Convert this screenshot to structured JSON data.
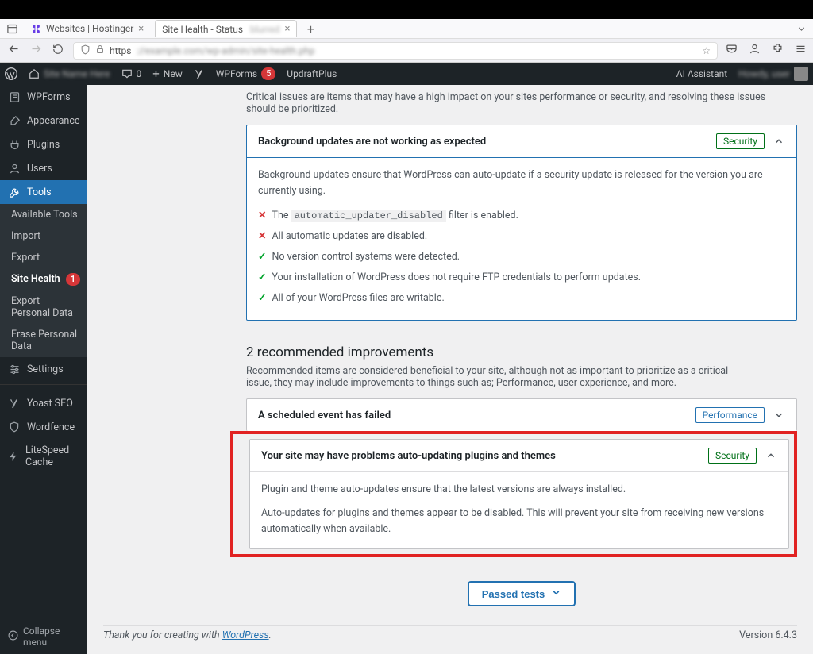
{
  "browser": {
    "tab1": "Websites | Hostinger",
    "tab2": "Site Health - Status",
    "url_prefix": "https",
    "url_rest": "://example.com/wp-admin/site-health.php",
    "add_tab": "+"
  },
  "adminbar": {
    "comments": "0",
    "new": "New",
    "wpforms": "WPForms",
    "wpforms_count": "5",
    "updraft": "UpdraftPlus",
    "aiassist": "AI Assistant",
    "howdy": "Howdy, user"
  },
  "sidebar": {
    "wpforms": "WPForms",
    "appearance": "Appearance",
    "plugins": "Plugins",
    "users": "Users",
    "tools": "Tools",
    "sub_available": "Available Tools",
    "sub_import": "Import",
    "sub_export": "Export",
    "sub_sitehealth": "Site Health",
    "sub_sh_badge": "1",
    "sub_exportpd": "Export Personal Data",
    "sub_erasepd": "Erase Personal Data",
    "settings": "Settings",
    "yoast": "Yoast SEO",
    "wordfence": "Wordfence",
    "litespeed": "LiteSpeed Cache",
    "collapse": "Collapse menu"
  },
  "content": {
    "critical_desc": "Critical issues are items that may have a high impact on your sites performance or security, and resolving these issues should be prioritized.",
    "issue1_title": "Background updates are not working as expected",
    "issue1_badge": "Security",
    "issue1_desc": "Background updates ensure that WordPress can auto-update if a security update is released for the version you are currently using.",
    "issue1_l1_pre": "The ",
    "issue1_l1_code": "automatic_updater_disabled",
    "issue1_l1_post": " filter is enabled.",
    "issue1_l2": "All automatic updates are disabled.",
    "issue1_l3": "No version control systems were detected.",
    "issue1_l4": "Your installation of WordPress does not require FTP credentials to perform updates.",
    "issue1_l5": "All of your WordPress files are writable.",
    "rec_title": "2 recommended improvements",
    "rec_desc": "Recommended items are considered beneficial to your site, although not as important to prioritize as a critical issue, they may include improvements to things such as; Performance, user experience, and more.",
    "rec1_title": "A scheduled event has failed",
    "rec1_badge": "Performance",
    "rec2_title": "Your site may have problems auto-updating plugins and themes",
    "rec2_badge": "Security",
    "rec2_p1": "Plugin and theme auto-updates ensure that the latest versions are always installed.",
    "rec2_p2": "Auto-updates for plugins and themes appear to be disabled. This will prevent your site from receiving new versions automatically when available.",
    "passed": "Passed tests",
    "footer_text": "Thank you for creating with ",
    "footer_link": "WordPress",
    "footer_dot": ".",
    "version": "Version 6.4.3"
  }
}
